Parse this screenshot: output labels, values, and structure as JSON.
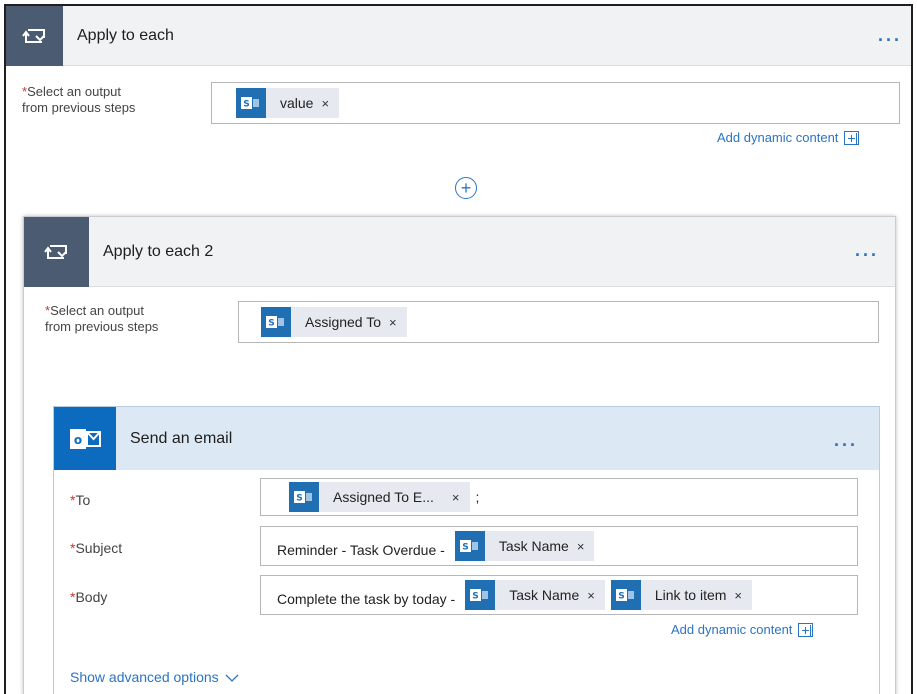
{
  "outer": {
    "title": "Apply to each",
    "more": "...",
    "select_label_line1": "Select an output",
    "select_label_line2": "from previous steps",
    "required_mark": "*",
    "token_value": "value",
    "add_dynamic": "Add dynamic content"
  },
  "inner": {
    "title": "Apply to each 2",
    "more": "...",
    "select_label_line1": "Select an output",
    "select_label_line2": "from previous steps",
    "token_value": "Assigned To"
  },
  "email": {
    "title": "Send an email",
    "more": "...",
    "to_label": "To",
    "to_token": "Assigned To E...",
    "to_suffix": ";",
    "subject_label": "Subject",
    "subject_text": "Reminder - Task Overdue -",
    "subject_token": "Task Name",
    "body_label": "Body",
    "body_text": "Complete the task by today -",
    "body_token1": "Task Name",
    "body_token2": "Link to item",
    "add_dynamic": "Add dynamic content",
    "show_advanced": "Show advanced options"
  },
  "token_close": "×",
  "icons": {
    "loop": "loop-icon",
    "sharepoint": "sharepoint-icon",
    "outlook": "outlook-icon",
    "add": "add-step-icon",
    "chevron": "chevron-down-icon"
  },
  "colors": {
    "loop_icon_bg": "#4b5b71",
    "sharepoint_bg": "#1f6fb2",
    "outlook_bg": "#0c6bbf",
    "link": "#2b74c2",
    "required": "#c0392b"
  }
}
